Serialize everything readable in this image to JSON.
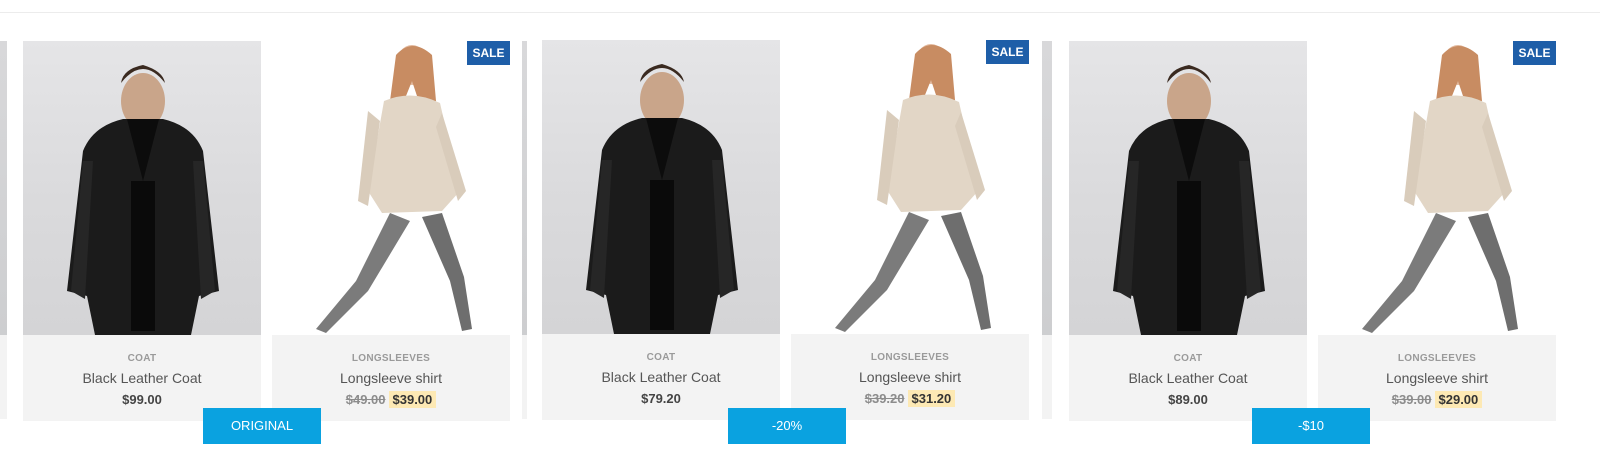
{
  "groups": [
    {
      "label": "ORIGINAL",
      "products": [
        {
          "category": "COAT",
          "name": "Black Leather Coat",
          "price": "$99.00"
        },
        {
          "category": "LONGSLEEVES",
          "name": "Longsleeve shirt",
          "old_price": "$49.00",
          "new_price": "$39.00",
          "badge": "SALE"
        }
      ]
    },
    {
      "label": "-20%",
      "products": [
        {
          "category": "COAT",
          "name": "Black Leather Coat",
          "price": "$79.20"
        },
        {
          "category": "LONGSLEEVES",
          "name": "Longsleeve shirt",
          "old_price": "$39.20",
          "new_price": "$31.20",
          "badge": "SALE"
        }
      ]
    },
    {
      "label": "-$10",
      "products": [
        {
          "category": "COAT",
          "name": "Black Leather Coat",
          "price": "$89.00"
        },
        {
          "category": "LONGSLEEVES",
          "name": "Longsleeve shirt",
          "old_price": "$39.00",
          "new_price": "$29.00",
          "badge": "SALE"
        }
      ]
    }
  ],
  "colors": {
    "badge": "#1e5ea8",
    "label_button": "#0aa2e0",
    "sale_price_highlight": "#fde9b4",
    "info_background": "#f3f3f3"
  }
}
